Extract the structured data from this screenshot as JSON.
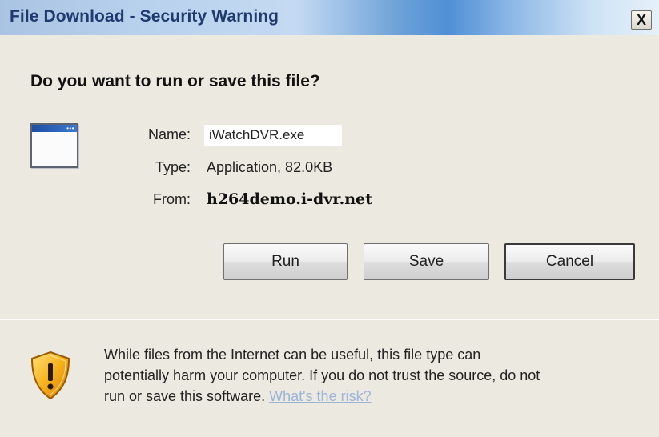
{
  "window": {
    "title": "File Download - Security Warning",
    "close_label": "X"
  },
  "dialog": {
    "question": "Do you want to run or save this file?",
    "file_icon": "application-window-icon",
    "name_label": "Name:",
    "name_value": "iWatchDVR.exe",
    "type_label": "Type:",
    "type_value": "Application, 82.0KB",
    "from_label": "From:",
    "from_value": "h264demo.i-dvr.net"
  },
  "buttons": {
    "run_label": "Run",
    "save_label": "Save",
    "cancel_label": "Cancel"
  },
  "warning": {
    "icon": "shield-warning-icon",
    "text_line1": "While files from the Internet can be useful, this file type can",
    "text_line2": "potentially harm your computer. If you do not trust the source, do not",
    "text_line3": "run or save this software.",
    "link_label": "What's the risk?",
    "link_color": "#9bb4d8"
  }
}
